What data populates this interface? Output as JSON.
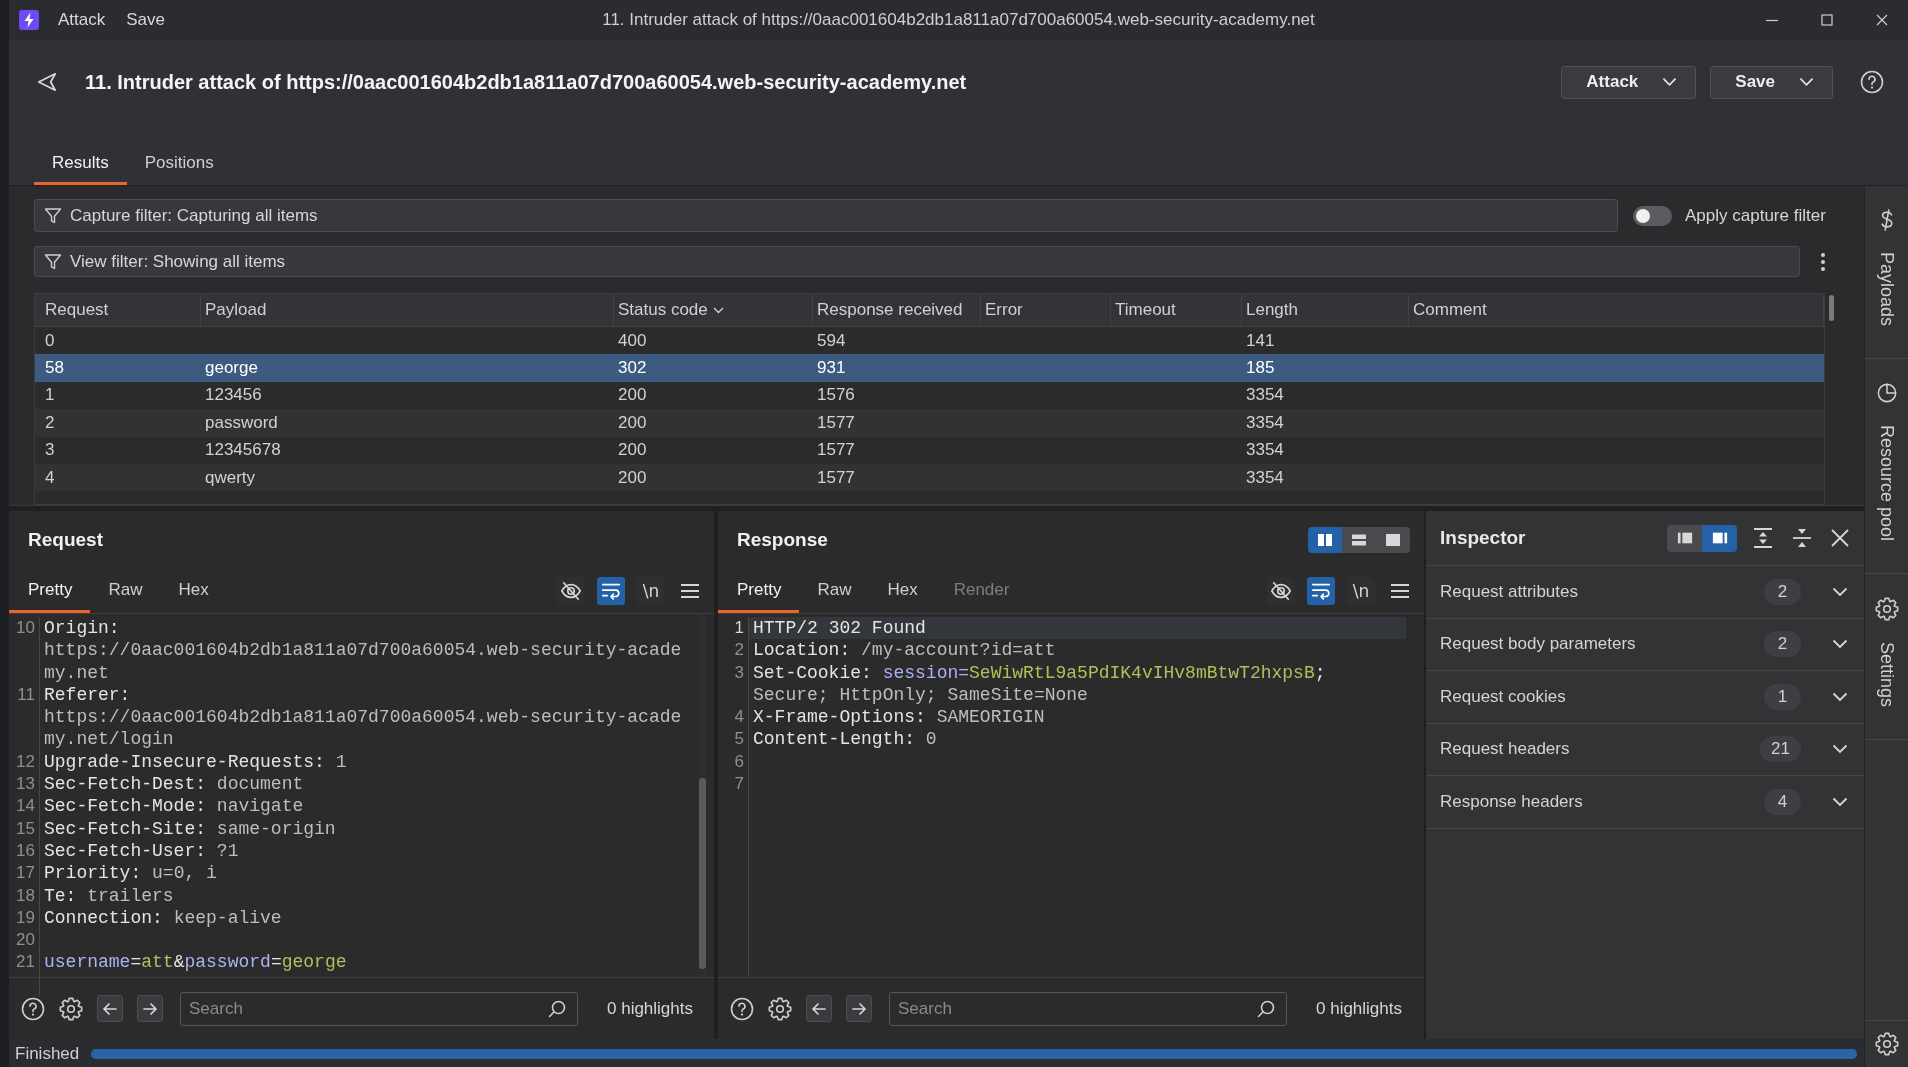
{
  "window": {
    "menu": [
      "Attack",
      "Save"
    ],
    "title": "11. Intruder attack of https://0aac001604b2db1a811a07d700a60054.web-security-academy.net"
  },
  "header": {
    "title": "11. Intruder attack of https://0aac001604b2db1a811a07d700a60054.web-security-academy.net",
    "buttons": [
      "Attack",
      "Save"
    ]
  },
  "tabs": [
    {
      "label": "Results",
      "selected": true
    },
    {
      "label": "Positions",
      "selected": false
    }
  ],
  "capture_filter": {
    "text": "Capture filter: Capturing all items",
    "toggle": {
      "label": "Apply capture filter",
      "on": false
    }
  },
  "view_filter": {
    "text": "View filter: Showing all items"
  },
  "table": {
    "columns": [
      {
        "label": "Request",
        "sorted": false
      },
      {
        "label": "Payload",
        "sorted": false
      },
      {
        "label": "Status code",
        "sorted": true
      },
      {
        "label": "Response received",
        "sorted": false
      },
      {
        "label": "Error",
        "sorted": false
      },
      {
        "label": "Timeout",
        "sorted": false
      },
      {
        "label": "Length",
        "sorted": false
      },
      {
        "label": "Comment",
        "sorted": false
      }
    ],
    "rows": [
      {
        "request": "0",
        "status_code": "400",
        "response_received": "594",
        "length": "141",
        "selected": false
      },
      {
        "request": "58",
        "payload": "george",
        "status_code": "302",
        "response_received": "931",
        "length": "185",
        "selected": true
      },
      {
        "request": "1",
        "payload": "123456",
        "status_code": "200",
        "response_received": "1576",
        "length": "3354",
        "selected": false
      },
      {
        "request": "2",
        "payload": "password",
        "status_code": "200",
        "response_received": "1577",
        "length": "3354",
        "selected": false
      },
      {
        "request": "3",
        "payload": "12345678",
        "status_code": "200",
        "response_received": "1577",
        "length": "3354",
        "selected": false
      },
      {
        "request": "4",
        "payload": "qwerty",
        "status_code": "200",
        "response_received": "1577",
        "length": "3354",
        "selected": false
      }
    ]
  },
  "request_pane": {
    "title": "Request",
    "tabs": [
      {
        "label": "Pretty",
        "selected": true
      },
      {
        "label": "Raw",
        "selected": false
      },
      {
        "label": "Hex",
        "selected": false
      }
    ],
    "toolbar": [
      {
        "kind": "hide",
        "on": false
      },
      {
        "kind": "wrap",
        "on": true
      },
      {
        "kind": "newline",
        "label": "\\n",
        "on": false
      },
      {
        "kind": "menu"
      }
    ],
    "editor": {
      "lines": [
        {
          "number": "10",
          "segments": [
            {
              "kind": "name",
              "text": "Origin:"
            },
            {
              "kind": "value",
              "text": " https://0aac001604b2db1a811a07d700a60054.web-security-academy.net"
            }
          ]
        },
        {
          "number": "11",
          "segments": [
            {
              "kind": "name",
              "text": "Referer:"
            },
            {
              "kind": "value",
              "text": " https://0aac001604b2db1a811a07d700a60054.web-security-academy.net/login"
            }
          ]
        },
        {
          "number": "12",
          "segments": [
            {
              "kind": "name",
              "text": "Upgrade-Insecure-Requests:"
            },
            {
              "kind": "value",
              "text": " 1"
            }
          ]
        },
        {
          "number": "13",
          "segments": [
            {
              "kind": "name",
              "text": "Sec-Fetch-Dest:"
            },
            {
              "kind": "value",
              "text": " document"
            }
          ]
        },
        {
          "number": "14",
          "segments": [
            {
              "kind": "name",
              "text": "Sec-Fetch-Mode:"
            },
            {
              "kind": "value",
              "text": " navigate"
            }
          ]
        },
        {
          "number": "15",
          "segments": [
            {
              "kind": "name",
              "text": "Sec-Fetch-Site:"
            },
            {
              "kind": "value",
              "text": " same-origin"
            }
          ]
        },
        {
          "number": "16",
          "segments": [
            {
              "kind": "name",
              "text": "Sec-Fetch-User:"
            },
            {
              "kind": "value",
              "text": " ?1"
            }
          ]
        },
        {
          "number": "17",
          "segments": [
            {
              "kind": "name",
              "text": "Priority:"
            },
            {
              "kind": "value",
              "text": " u=0, i"
            }
          ]
        },
        {
          "number": "18",
          "segments": [
            {
              "kind": "name",
              "text": "Te:"
            },
            {
              "kind": "value",
              "text": " trailers"
            }
          ]
        },
        {
          "number": "19",
          "segments": [
            {
              "kind": "name",
              "text": "Connection:"
            },
            {
              "kind": "value",
              "text": " keep-alive"
            }
          ]
        },
        {
          "number": "20"
        },
        {
          "number": "21",
          "segments": [
            {
              "kind": "key",
              "text": "username"
            },
            {
              "kind": "punct",
              "text": "="
            },
            {
              "kind": "data",
              "text": "att"
            },
            {
              "kind": "punct",
              "text": "&"
            },
            {
              "kind": "key",
              "text": "password"
            },
            {
              "kind": "punct",
              "text": "="
            },
            {
              "kind": "data",
              "text": "george"
            }
          ]
        }
      ]
    },
    "search": {
      "placeholder": "Search",
      "highlights": "0 highlights"
    }
  },
  "response_pane": {
    "title": "Response",
    "layout": [
      {
        "kind": "columns",
        "selected": true
      },
      {
        "kind": "rows",
        "selected": false
      },
      {
        "kind": "single",
        "selected": false
      }
    ],
    "tabs": [
      {
        "label": "Pretty",
        "selected": true,
        "disabled": false
      },
      {
        "label": "Raw",
        "selected": false,
        "disabled": false
      },
      {
        "label": "Hex",
        "selected": false,
        "disabled": false
      },
      {
        "label": "Render",
        "selected": false,
        "disabled": true
      }
    ],
    "toolbar": [
      {
        "kind": "hide",
        "on": false
      },
      {
        "kind": "wrap",
        "on": true
      },
      {
        "kind": "newline",
        "label": "\\n",
        "on": false
      },
      {
        "kind": "menu"
      }
    ],
    "editor": {
      "lines": [
        {
          "number": "1",
          "current": true,
          "segments": [
            {
              "kind": "name",
              "text": "HTTP/2 302 Found"
            }
          ]
        },
        {
          "number": "2",
          "current": false,
          "segments": [
            {
              "kind": "name",
              "text": "Location:"
            },
            {
              "kind": "value",
              "text": " /my-account?id=att"
            }
          ]
        },
        {
          "number": "3",
          "current": false,
          "segments": [
            {
              "kind": "name",
              "text": "Set-Cookie: "
            },
            {
              "kind": "key",
              "text": "session="
            },
            {
              "kind": "data",
              "text": "SeWiwRtL9a5PdIK4vIHv8mBtwT2hxpsB"
            },
            {
              "kind": "punct",
              "text": ";"
            },
            {
              "kind": "value",
              "text": " Secure; HttpOnly; SameSite=None"
            }
          ]
        },
        {
          "number": "4",
          "current": false,
          "segments": [
            {
              "kind": "name",
              "text": "X-Frame-Options:"
            },
            {
              "kind": "value",
              "text": " SAMEORIGIN"
            }
          ]
        },
        {
          "number": "5",
          "current": false,
          "segments": [
            {
              "kind": "name",
              "text": "Content-Length:"
            },
            {
              "kind": "value",
              "text": " 0"
            }
          ]
        },
        {
          "number": "6",
          "current": false
        },
        {
          "number": "7",
          "current": false
        }
      ]
    },
    "search": {
      "placeholder": "Search",
      "highlights": "0 highlights"
    }
  },
  "inspector": {
    "title": "Inspector",
    "layout": [
      {
        "kind": "left",
        "selected": false
      },
      {
        "kind": "right",
        "selected": true
      }
    ],
    "sections": [
      {
        "label": "Request attributes",
        "count": "2",
        "expanded": false
      },
      {
        "label": "Request body parameters",
        "count": "2",
        "expanded": false
      },
      {
        "label": "Request cookies",
        "count": "1",
        "expanded": false
      },
      {
        "label": "Request headers",
        "count": "21",
        "expanded": false
      },
      {
        "label": "Response headers",
        "count": "4",
        "expanded": false
      }
    ]
  },
  "sidebar": {
    "items": [
      "Payloads",
      "Resource pool",
      "Settings"
    ]
  },
  "status_bar": {
    "text": "Finished",
    "progress": {
      "level": 1
    }
  }
}
